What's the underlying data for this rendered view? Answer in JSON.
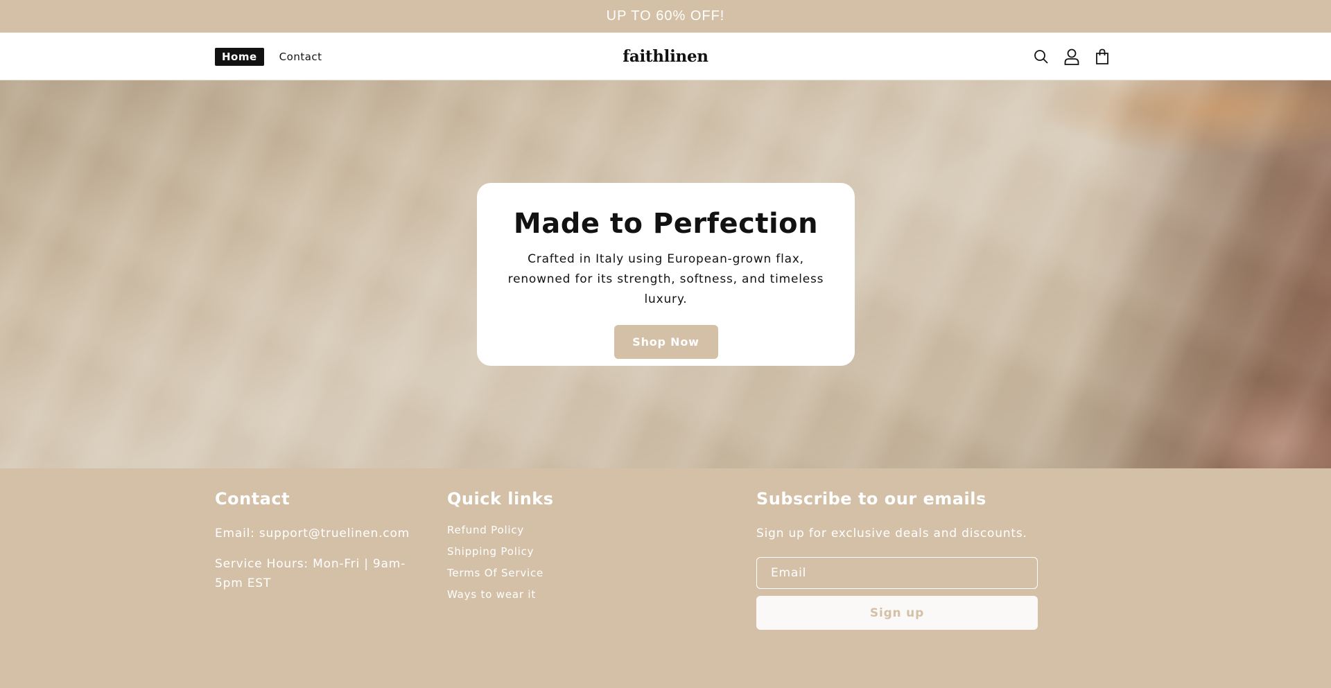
{
  "announcement": {
    "text": "UP TO 60% OFF!"
  },
  "header": {
    "nav": [
      {
        "label": "Home",
        "active": true
      },
      {
        "label": "Contact",
        "active": false
      }
    ],
    "logo": "faithlinen",
    "icons": [
      "search-icon",
      "account-icon",
      "cart-icon"
    ]
  },
  "hero": {
    "title": "Made to Perfection",
    "description": "Crafted in Italy using European-grown flax, renowned for its strength, softness, and timeless luxury.",
    "button_label": "Shop Now"
  },
  "footer": {
    "contact": {
      "heading": "Contact",
      "email": "Email: support@truelinen.com",
      "hours": "Service Hours: Mon-Fri | 9am-5pm EST"
    },
    "quick_links": {
      "heading": "Quick links",
      "links": [
        "Refund Policy",
        "Shipping Policy",
        "Terms Of Service",
        "Ways to wear it"
      ]
    },
    "subscribe": {
      "heading": "Subscribe to our emails",
      "text": "Sign up for exclusive deals and discounts.",
      "email_placeholder": "Email",
      "button_label": "Sign up"
    }
  },
  "colors": {
    "accent": "#d4c0a7",
    "text": "#121212",
    "white": "#ffffff"
  }
}
